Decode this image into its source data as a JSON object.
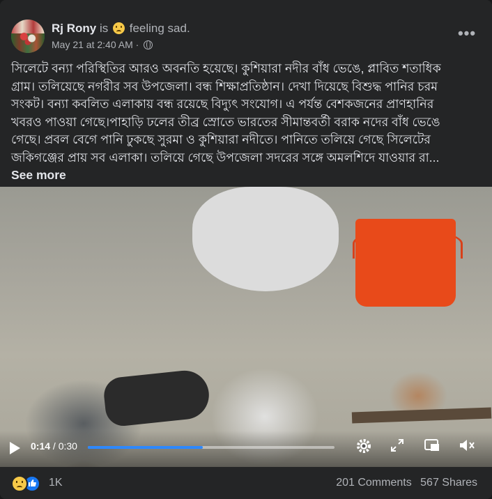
{
  "post": {
    "author": "Rj Rony",
    "is_text": "is",
    "feeling_text": "feeling sad.",
    "date": "May 21 at 2:40 AM",
    "date_separator": "·",
    "more_options": "•••",
    "body_text": "সিলেটে বন্যা পরিস্থিতির আরও অবনতি হয়েছে। কুশিয়ারা নদীর বাঁধ ভেঙে, প্লাবিত শতাধিক গ্রাম। তলিয়েছে নগরীর সব উপজেলা। বন্ধ শিক্ষাপ্রতিষ্ঠান। দেখা দিয়েছে বিশুদ্ধ পানির চরম সংকট। বন্যা কবলিত এলাকায় বন্ধ রয়েছে বিদ্যুৎ সংযোগ। এ পর্যন্ত বেশকজনের প্রাণহানির খবরও পাওয়া গেছে।পাহাড়ি ঢলের তীব্র স্রোতে ভারতের সীমান্তবর্তী বরাক নদের বাঁধ ভেঙে গেছে। প্রবল বেগে পানি ঢুকছে সুরমা ও কুশিয়ারা নদীতে। পানিতে তলিয়ে গেছে সিলেটের জকিগঞ্জের প্রায় সব এলাকা। তলিয়ে গেছে উপজেলা সদরের সঙ্গে অমলশিদে যাওয়ার রা...",
    "see_more": "See more"
  },
  "video": {
    "current_time": "0:14",
    "separator": " / ",
    "duration": "0:30",
    "progress": 0.467
  },
  "reactions": {
    "count": "1K",
    "comments": "201 Comments",
    "shares": "567 Shares"
  },
  "icons": {
    "play": "play-icon",
    "settings": "gear-icon",
    "fullscreen": "expand-icon",
    "pip": "picture-in-picture-icon",
    "mute": "volume-muted-icon",
    "globe": "globe-icon"
  },
  "colors": {
    "background": "#242526",
    "accent": "#2d88ff",
    "text": "#e4e6eb",
    "muted": "#b0b3b8"
  }
}
